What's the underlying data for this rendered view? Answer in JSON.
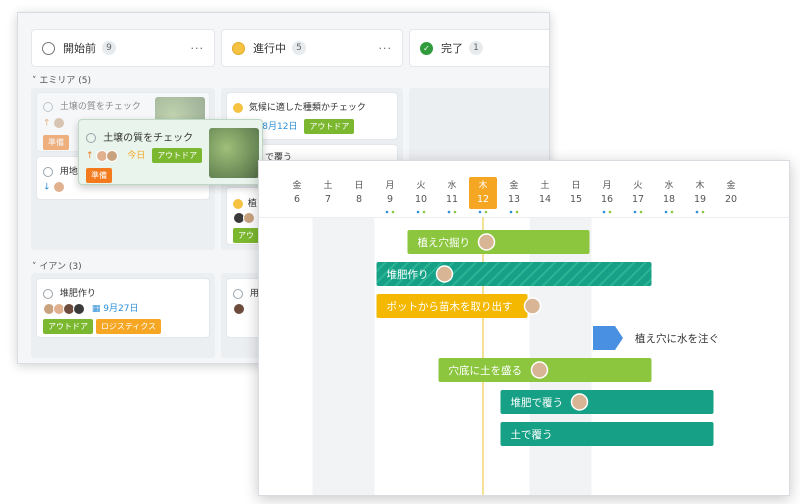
{
  "board": {
    "columns": [
      {
        "label": "開始前",
        "count": "9",
        "status": "todo"
      },
      {
        "label": "進行中",
        "count": "5",
        "status": "progress"
      },
      {
        "label": "完了",
        "count": "1",
        "status": "done"
      }
    ],
    "groups": [
      {
        "label": "エミリア (5)"
      },
      {
        "label": "イアン (3)"
      }
    ],
    "cards": {
      "soil_check": {
        "title": "土壌の質をチェック",
        "tag": "準備",
        "due": "今日",
        "tag2": "アウトドア"
      },
      "soil_check_bg": {
        "title": "土壌の質をチェック",
        "tag": "準備"
      },
      "land": {
        "title": "用地選"
      },
      "plant_type": {
        "title": "気候に適した種類かチェック",
        "date": "8月12日",
        "tag": "アウトドア"
      },
      "cover": {
        "title": "で覆う"
      },
      "plant_cut": {
        "title": "植え"
      },
      "plant_cut_tag": {
        "tag": "アウ"
      },
      "compost": {
        "title": "堆肥作り",
        "date": "9月27日",
        "tags": [
          "アウトドア",
          "ロジスティクス"
        ]
      },
      "land2": {
        "title": "用地"
      }
    }
  },
  "gantt": {
    "days": [
      {
        "dow": "金",
        "date": "6"
      },
      {
        "dow": "土",
        "date": "7"
      },
      {
        "dow": "日",
        "date": "8"
      },
      {
        "dow": "月",
        "date": "9"
      },
      {
        "dow": "火",
        "date": "10"
      },
      {
        "dow": "水",
        "date": "11"
      },
      {
        "dow": "木",
        "date": "12",
        "today": true
      },
      {
        "dow": "金",
        "date": "13"
      },
      {
        "dow": "土",
        "date": "14"
      },
      {
        "dow": "日",
        "date": "15"
      },
      {
        "dow": "月",
        "date": "16"
      },
      {
        "dow": "火",
        "date": "17"
      },
      {
        "dow": "水",
        "date": "18"
      },
      {
        "dow": "木",
        "date": "19"
      },
      {
        "dow": "金",
        "date": "20"
      }
    ],
    "tasks": [
      {
        "label": "植え穴掘り",
        "start": 10,
        "end": 15,
        "color": "#8cc63f",
        "avatar": true
      },
      {
        "label": "堆肥作り",
        "start": 9,
        "end": 17,
        "color": "#16a085",
        "hatched": true,
        "avatar": true
      },
      {
        "label": "ポットから苗木を取り出す",
        "start": 9,
        "end": 13,
        "color": "#f5b800",
        "avatar": true
      },
      {
        "label": "植え穴に水を注ぐ",
        "start": 16,
        "end": 16,
        "color": "#4a90e2",
        "milestone": true
      },
      {
        "label": "穴底に土を盛る",
        "start": 11,
        "end": 17,
        "color": "#8cc63f",
        "avatar": true
      },
      {
        "label": "堆肥で覆う",
        "start": 13,
        "end": 19,
        "color": "#16a085",
        "avatar": true
      },
      {
        "label": "土で覆う",
        "start": 13,
        "end": 19,
        "color": "#16a085",
        "avatar": false
      }
    ],
    "colors": {
      "weekend": "#f2f3f4",
      "today": "#f5a623",
      "todayLine": "#f0d770",
      "text": "#555555"
    }
  }
}
